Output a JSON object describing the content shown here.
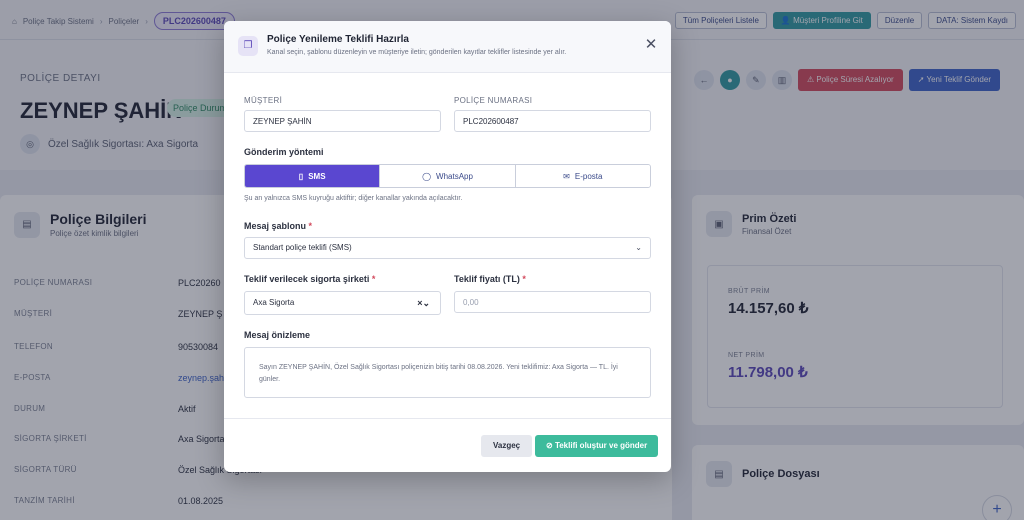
{
  "topbar": {
    "breadcrumbs": [
      "Poliçe Takip Sistemi",
      "Poliçeler"
    ],
    "current_chip": "PLC202600487",
    "actions": [
      "Tüm Poliçeleri Listele",
      "Müşteri Profiline Git",
      "Düzenle",
      "DATA: Sistem Kaydı"
    ]
  },
  "header": {
    "section_label": "POLİÇE DETAYI",
    "customer_name": "ZEYNEP ŞAHİN",
    "status_badge": "Poliçe Durum",
    "subtitle": "Özel Sağlık Sigortası: Axa Sigorta",
    "btn_expiring": "⚠ Poliçe Süresi Azalıyor",
    "btn_new_offer": "Yeni Teklif Gönder"
  },
  "policy_card": {
    "title": "Poliçe Bilgileri",
    "subtitle": "Poliçe özet kimlik bilgileri",
    "rows": [
      {
        "k": "POLİÇE NUMARASI",
        "v": "PLC20260"
      },
      {
        "k": "MÜŞTERİ",
        "v": "ZEYNEP Ş"
      },
      {
        "k": "TELEFON",
        "v": "90530084"
      },
      {
        "k": "E-POSTA",
        "v": "zeynep.şah"
      },
      {
        "k": "DURUM",
        "v": "Aktif"
      },
      {
        "k": "SİGORTA ŞİRKETİ",
        "v": "Axa Sigorta"
      },
      {
        "k": "SİGORTA TÜRÜ",
        "v": "Özel Sağlık Sigortası"
      },
      {
        "k": "TANZİM TARİHİ",
        "v": "01.08.2025"
      }
    ]
  },
  "premium_card": {
    "title": "Prim Özeti",
    "subtitle": "Finansal Özet",
    "gross_label": "BRÜT PRİM",
    "gross_value": "14.157,60 ₺",
    "net_label": "NET PRİM",
    "net_value": "11.798,00 ₺"
  },
  "file_card": {
    "title": "Poliçe Dosyası"
  },
  "modal": {
    "title": "Poliçe Yenileme Teklifi Hazırla",
    "description": "Kanal seçin, şablonu düzenleyin ve müşteriye iletin; gönderilen kayıtlar teklifler listesinde yer alır.",
    "customer_label": "MÜŞTERİ",
    "customer_value": "ZEYNEP ŞAHİN",
    "policy_label": "POLİÇE NUMARASI",
    "policy_value": "PLC202600487",
    "send_method_label": "Gönderim yöntemi",
    "channels": [
      {
        "label": "SMS",
        "icon": "phone-icon",
        "active": true
      },
      {
        "label": "WhatsApp",
        "icon": "chat-icon",
        "active": false
      },
      {
        "label": "E-posta",
        "icon": "mail-icon",
        "active": false
      }
    ],
    "channel_hint": "Şu an yalnızca SMS kuyruğu aktiftir; diğer kanallar yakında açılacaktır.",
    "template_label": "Mesaj şablonu",
    "template_value": "Standart poliçe teklifi (SMS)",
    "company_label": "Teklif verilecek sigorta şirketi",
    "company_value": "Axa Sigorta",
    "price_label": "Teklif fiyatı (TL)",
    "price_placeholder": "0,00",
    "preview_label": "Mesaj önizleme",
    "preview_text": "Sayın ZEYNEP ŞAHİN, Özel Sağlık Sigortası poliçenizin bitiş tarihi 08.08.2026. Yeni teklifimiz: Axa Sigorta — TL. İyi günler.",
    "cancel_label": "Vazgeç",
    "submit_label": "Teklifi oluştur ve gönder"
  }
}
